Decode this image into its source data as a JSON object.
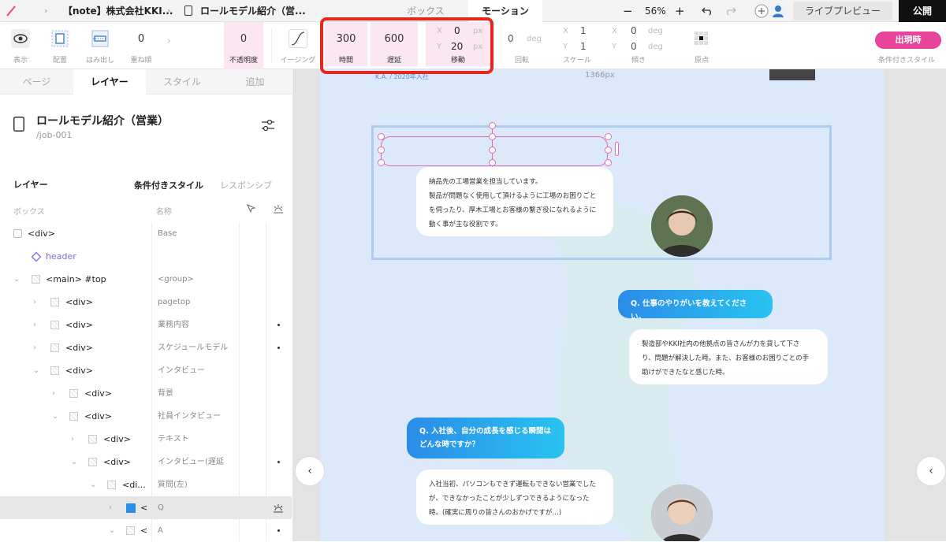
{
  "topbar": {
    "breadcrumb_company": "【note】株式会社KKI...",
    "breadcrumb_page": "ロールモデル紹介（営...",
    "tab_box": "ボックス",
    "tab_motion": "モーション",
    "zoom_minus": "−",
    "zoom": "56%",
    "zoom_plus": "+",
    "live_preview": "ライブプレビュー",
    "publish": "公開"
  },
  "toolbar": {
    "display": "表示",
    "placement": "配置",
    "overflow": "はみ出し",
    "stack_order_value": "0",
    "stack_order": "重ね順",
    "opacity_value": "0",
    "opacity": "不透明度",
    "easing": "イージング",
    "duration_value": "300",
    "duration": "時間",
    "delay_value": "600",
    "delay": "遅延",
    "move_x_label": "X",
    "move_x_value": "0",
    "move_x_unit": "px",
    "move_y_label": "Y",
    "move_y_value": "20",
    "move_y_unit": "px",
    "move": "移動",
    "rotate_value": "0",
    "rotate_unit": "deg",
    "rotate": "回転",
    "scale_x_label": "X",
    "scale_x_value": "1",
    "scale_y_label": "Y",
    "scale_y_value": "1",
    "scale": "スケール",
    "skew_x_label": "X",
    "skew_x_value": "0",
    "skew_x_unit": "deg",
    "skew_y_label": "Y",
    "skew_y_value": "0",
    "skew_y_unit": "deg",
    "skew": "傾き",
    "origin": "原点",
    "appear_button": "出現時",
    "conditional_style": "条件付きスタイル"
  },
  "panel": {
    "tabs": [
      "ページ",
      "レイヤー",
      "スタイル",
      "追加"
    ],
    "page_title": "ロールモデル紹介（営業）",
    "page_slug": "/job-001",
    "layer_heading": "レイヤー",
    "subtab_conditional": "条件付きスタイル",
    "subtab_responsive": "レスポンシブ",
    "col_box": "ボックス",
    "col_name": "名称",
    "rows": [
      {
        "node": "<div>",
        "name": "Base"
      },
      {
        "node": "header",
        "name": ""
      },
      {
        "node": "<main> #top",
        "name": "<group>"
      },
      {
        "node": "<div>",
        "name": "pagetop"
      },
      {
        "node": "<div>",
        "name": "業務内容"
      },
      {
        "node": "<div>",
        "name": "スケジュールモデル"
      },
      {
        "node": "<div>",
        "name": "インタビュー"
      },
      {
        "node": "<div>",
        "name": "背景"
      },
      {
        "node": "<div>",
        "name": "社員インタビュー"
      },
      {
        "node": "<div>",
        "name": "テキスト"
      },
      {
        "node": "<div>",
        "name": "インタビュー(遅延"
      },
      {
        "node": "<di...",
        "name": "質問(左)"
      },
      {
        "node": "<",
        "name": "Q"
      },
      {
        "node": "<",
        "name": "A"
      }
    ]
  },
  "canvas": {
    "top_caption": "K.A. / 2020年入社",
    "width_label": "1366px",
    "answer1": "納品先の工場営業を担当しています。\n製品が問題なく使用して頂けるように工場のお困りごと\nを伺ったり、厚木工場とお客様の繋ぎ役になれるように\n動く事が主な役割です。",
    "question2": "Q. 仕事のやりがいを教えてください。",
    "answer2": "製造部やKKI社内の他拠点の皆さんが力を貸して下さ\nり、問題が解決した時。また、お客様のお困りごとの手\n助けができたなと感じた時。",
    "question3": "Q. 入社後、自分の成長を感じる瞬間は\nどんな時ですか？",
    "answer3": "入社当初、パソコンもできず運転もできない営業でした\nが、できなかったことが少しずつできるようになった\n時。(確実に周りの皆さんのおかげですが…)",
    "nav_prev": "‹"
  },
  "colors": {
    "accent_pink": "#e8449b",
    "highlight_red": "#e8261c",
    "gradient_start": "#2a8ce8",
    "gradient_end": "#29c3f1",
    "artboard_bg": "#dbe9fb"
  }
}
